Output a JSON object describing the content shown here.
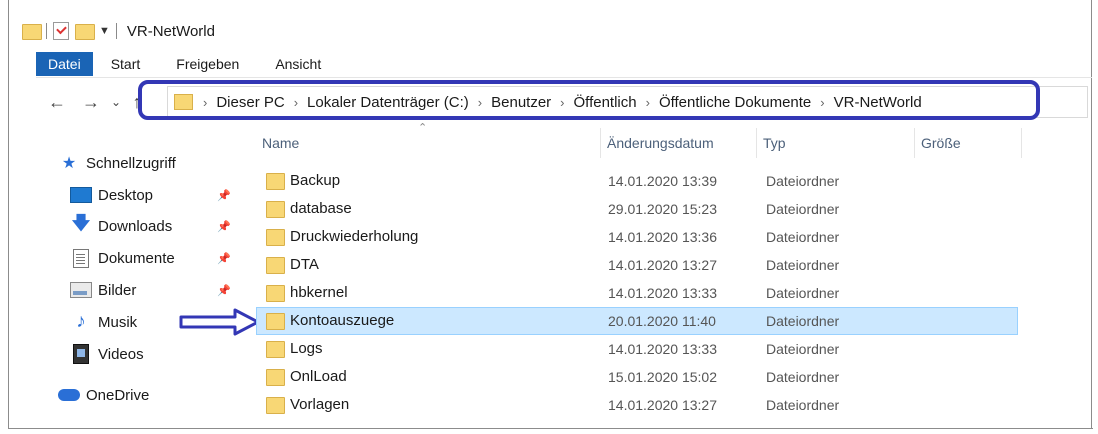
{
  "titlebar": {
    "title": "VR-NetWorld",
    "quick_access_dropdown_icon": "dropdown-arrow-icon"
  },
  "ribbon": {
    "tabs": [
      {
        "label": "Datei",
        "active": true
      },
      {
        "label": "Start",
        "active": false
      },
      {
        "label": "Freigeben",
        "active": false
      },
      {
        "label": "Ansicht",
        "active": false
      }
    ]
  },
  "nav": {
    "back_icon": "arrow-left-icon",
    "forward_icon": "arrow-right-icon",
    "recent_icon": "chevron-down-icon",
    "up_icon": "arrow-up-icon"
  },
  "address": {
    "crumbs": [
      "Dieser PC",
      "Lokaler Datenträger (C:)",
      "Benutzer",
      "Öffentlich",
      "Öffentliche Dokumente",
      "VR-NetWorld"
    ],
    "highlight_color": "#3337b5"
  },
  "sidebar": {
    "items": [
      {
        "label": "Schnellzugriff",
        "icon": "star-icon",
        "pinned": false
      },
      {
        "label": "Desktop",
        "icon": "desktop-icon",
        "pinned": true
      },
      {
        "label": "Downloads",
        "icon": "download-icon",
        "pinned": true
      },
      {
        "label": "Dokumente",
        "icon": "document-icon",
        "pinned": true
      },
      {
        "label": "Bilder",
        "icon": "pictures-icon",
        "pinned": true
      },
      {
        "label": "Musik",
        "icon": "music-icon",
        "pinned": false
      },
      {
        "label": "Videos",
        "icon": "video-icon",
        "pinned": false
      },
      {
        "label": "OneDrive",
        "icon": "cloud-icon",
        "pinned": false
      }
    ]
  },
  "list": {
    "columns": [
      "Name",
      "Änderungsdatum",
      "Typ",
      "Größe"
    ],
    "sorted_by": "Name",
    "rows": [
      {
        "name": "Backup",
        "date": "14.01.2020 13:39",
        "type": "Dateiordner",
        "selected": false
      },
      {
        "name": "database",
        "date": "29.01.2020 15:23",
        "type": "Dateiordner",
        "selected": false
      },
      {
        "name": "Druckwiederholung",
        "date": "14.01.2020 13:36",
        "type": "Dateiordner",
        "selected": false
      },
      {
        "name": "DTA",
        "date": "14.01.2020 13:27",
        "type": "Dateiordner",
        "selected": false
      },
      {
        "name": "hbkernel",
        "date": "14.01.2020 13:33",
        "type": "Dateiordner",
        "selected": false
      },
      {
        "name": "Kontoauszuege",
        "date": "20.01.2020 11:40",
        "type": "Dateiordner",
        "selected": true
      },
      {
        "name": "Logs",
        "date": "14.01.2020 13:33",
        "type": "Dateiordner",
        "selected": false
      },
      {
        "name": "OnlLoad",
        "date": "15.01.2020 15:02",
        "type": "Dateiordner",
        "selected": false
      },
      {
        "name": "Vorlagen",
        "date": "14.01.2020 13:27",
        "type": "Dateiordner",
        "selected": false
      }
    ],
    "selection_color": "#cce8ff"
  },
  "annotation": {
    "arrow_color": "#3337b5",
    "points_to": "Kontoauszuege"
  }
}
